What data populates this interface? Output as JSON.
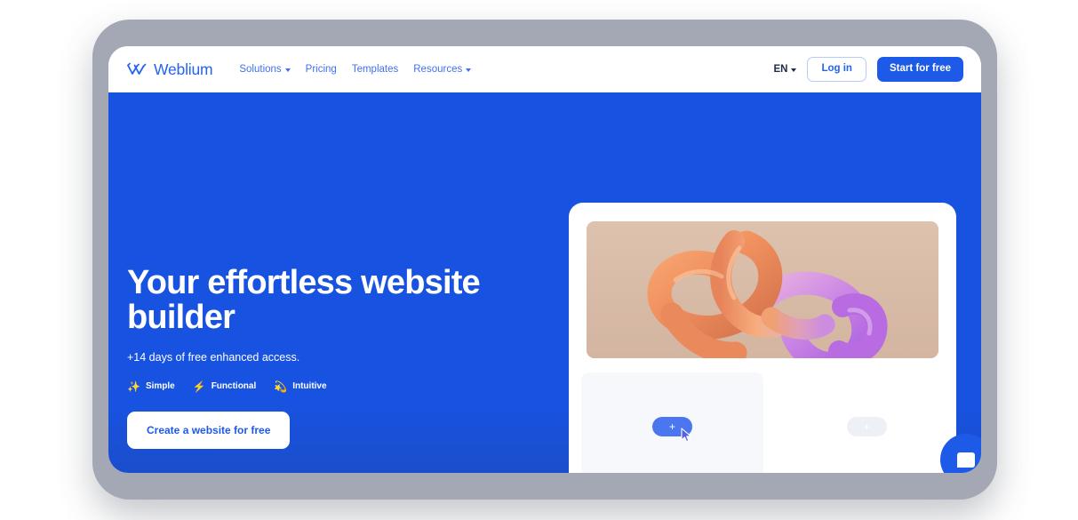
{
  "brand": {
    "name": "Weblium",
    "logo_icon": "weblium-w-mark-icon",
    "accent_blue": "#1d5ae8",
    "nav_blue": "#4071f0",
    "hero_bg": "#1852e0"
  },
  "header": {
    "nav": [
      {
        "label": "Solutions",
        "has_dropdown": true
      },
      {
        "label": "Pricing",
        "has_dropdown": false
      },
      {
        "label": "Templates",
        "has_dropdown": false
      },
      {
        "label": "Resources",
        "has_dropdown": true
      }
    ],
    "language": "EN",
    "login_label": "Log in",
    "start_label": "Start for free"
  },
  "hero": {
    "title": "Your effortless website builder",
    "subtitle": "+14 days of free enhanced access.",
    "badges": [
      {
        "icon": "sparkles-icon",
        "glyph": "✨",
        "label": "Simple"
      },
      {
        "icon": "lightning-bolt-icon",
        "glyph": "⚡",
        "label": "Functional"
      },
      {
        "icon": "comet-icon",
        "glyph": "💫",
        "label": "Intuitive"
      }
    ],
    "cta_label": "Create a website for free"
  },
  "preview": {
    "image_alt": "3d-abstract-knot-illustration",
    "image_bg": "#d9bda9",
    "blocks": [
      {
        "name": "block-slot-active",
        "plus_label": "+",
        "state": "active",
        "color": "#4a76f0"
      },
      {
        "name": "block-slot-idle",
        "plus_label": "+",
        "state": "idle",
        "color": "#edf0f5"
      }
    ]
  },
  "chat": {
    "icon": "chat-bubble-icon"
  }
}
